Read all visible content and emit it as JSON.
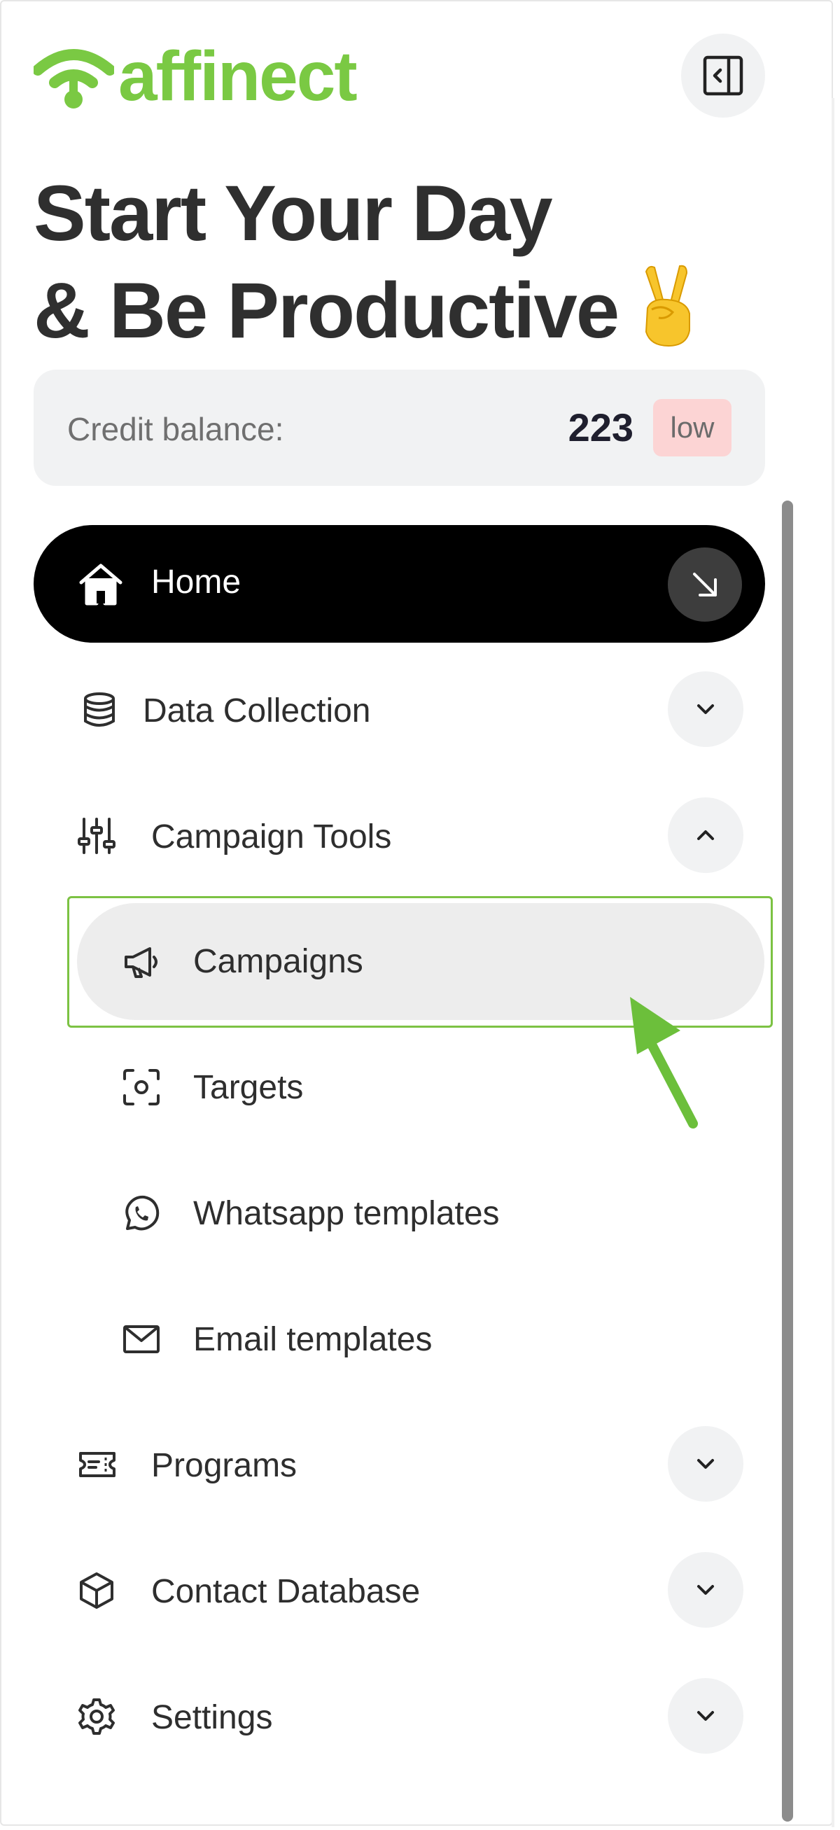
{
  "brand": {
    "name": "affinect",
    "accent": "#7ac943"
  },
  "header": {
    "headline_line1": "Start Your Day",
    "headline_line2": "& Be Productive",
    "collapse_icon": "sidebar-collapse-icon"
  },
  "credit": {
    "label": "Credit balance:",
    "value": "223",
    "badge": "low",
    "badge_color": "#fcd4d4"
  },
  "nav": {
    "home": {
      "label": "Home",
      "icon": "home-icon",
      "action_icon": "arrow-down-right-icon"
    },
    "data_collection": {
      "label": "Data Collection",
      "icon": "database-icon",
      "expanded": false
    },
    "campaign_tools": {
      "label": "Campaign Tools",
      "icon": "sliders-icon",
      "expanded": true,
      "items": [
        {
          "label": "Campaigns",
          "icon": "megaphone-icon",
          "active": true
        },
        {
          "label": "Targets",
          "icon": "target-icon"
        },
        {
          "label": "Whatsapp templates",
          "icon": "whatsapp-icon"
        },
        {
          "label": "Email templates",
          "icon": "mail-icon"
        }
      ]
    },
    "programs": {
      "label": "Programs",
      "icon": "ticket-icon",
      "expanded": false
    },
    "contact_database": {
      "label": "Contact Database",
      "icon": "cube-icon",
      "expanded": false
    },
    "settings": {
      "label": "Settings",
      "icon": "gear-icon",
      "expanded": false
    }
  },
  "annotation": {
    "highlight_color": "#7cc243"
  }
}
